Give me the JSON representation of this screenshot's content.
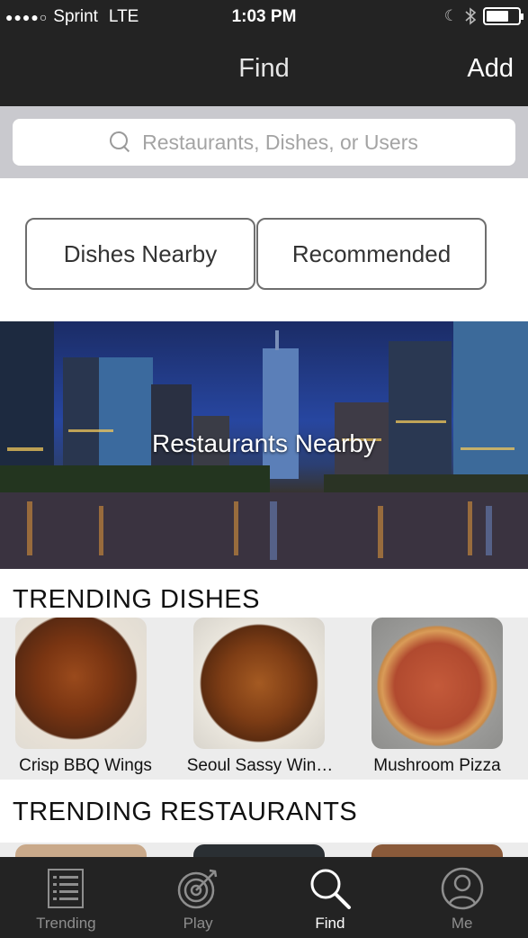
{
  "status_bar": {
    "carrier": "Sprint",
    "network": "LTE",
    "time": "1:03 PM"
  },
  "nav": {
    "title": "Find",
    "right_button": "Add"
  },
  "search": {
    "placeholder": "Restaurants, Dishes, or Users"
  },
  "segments": {
    "left": "Dishes Nearby",
    "right": "Recommended"
  },
  "hero": {
    "label": "Restaurants Nearby"
  },
  "trending_dishes": {
    "title": "TRENDING DISHES",
    "items": [
      {
        "label": "Crisp BBQ Wings"
      },
      {
        "label": "Seoul Sassy Win…"
      },
      {
        "label": "Mushroom Pizza"
      }
    ]
  },
  "trending_restaurants": {
    "title": "TRENDING RESTAURANTS"
  },
  "tabs": [
    {
      "label": "Trending",
      "icon": "list-icon"
    },
    {
      "label": "Play",
      "icon": "target-icon"
    },
    {
      "label": "Find",
      "icon": "search-icon"
    },
    {
      "label": "Me",
      "icon": "user-icon"
    }
  ],
  "colors": {
    "bar_background": "#232323",
    "search_area": "#c9c9ce",
    "tab_inactive": "#8e8e8e",
    "tab_active": "#ffffff"
  }
}
